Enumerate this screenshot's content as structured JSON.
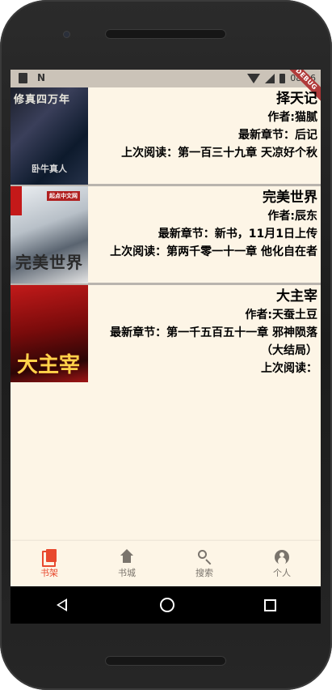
{
  "status_bar": {
    "time": "08:46",
    "debug_label": "DEBUG"
  },
  "books": [
    {
      "title": "择天记",
      "author": "作者:猫腻",
      "latest": "最新章节：后记",
      "last_read": "上次阅读：第一百三十九章 天凉好个秋",
      "cover_text_top": "修真四万年",
      "cover_text_bottom": "卧牛真人"
    },
    {
      "title": "完美世界",
      "author": "作者:辰东",
      "latest": "最新章节：新书，11月1日上传",
      "last_read": "上次阅读：第两千零一十一章 他化自在者",
      "cover_tag": "起点中文网",
      "cover_text_main": "完美世界"
    },
    {
      "title": "大主宰",
      "author": "作者:天蚕土豆",
      "latest": "最新章节：第一千五百五十一章 邪神陨落",
      "latest_cont": "（大结局）",
      "last_read": "上次阅读：",
      "cover_text_main": "大主宰"
    }
  ],
  "bottom_nav": [
    {
      "label": "书架",
      "icon": "bookshelf-icon",
      "active": true
    },
    {
      "label": "书城",
      "icon": "home-icon",
      "active": false
    },
    {
      "label": "搜索",
      "icon": "search-icon",
      "active": false
    },
    {
      "label": "个人",
      "icon": "person-icon",
      "active": false
    }
  ],
  "colors": {
    "background": "#fdf5e6",
    "active_tab": "#e8492e",
    "inactive_tab": "#7a746c",
    "divider": "#b9b4ae"
  }
}
